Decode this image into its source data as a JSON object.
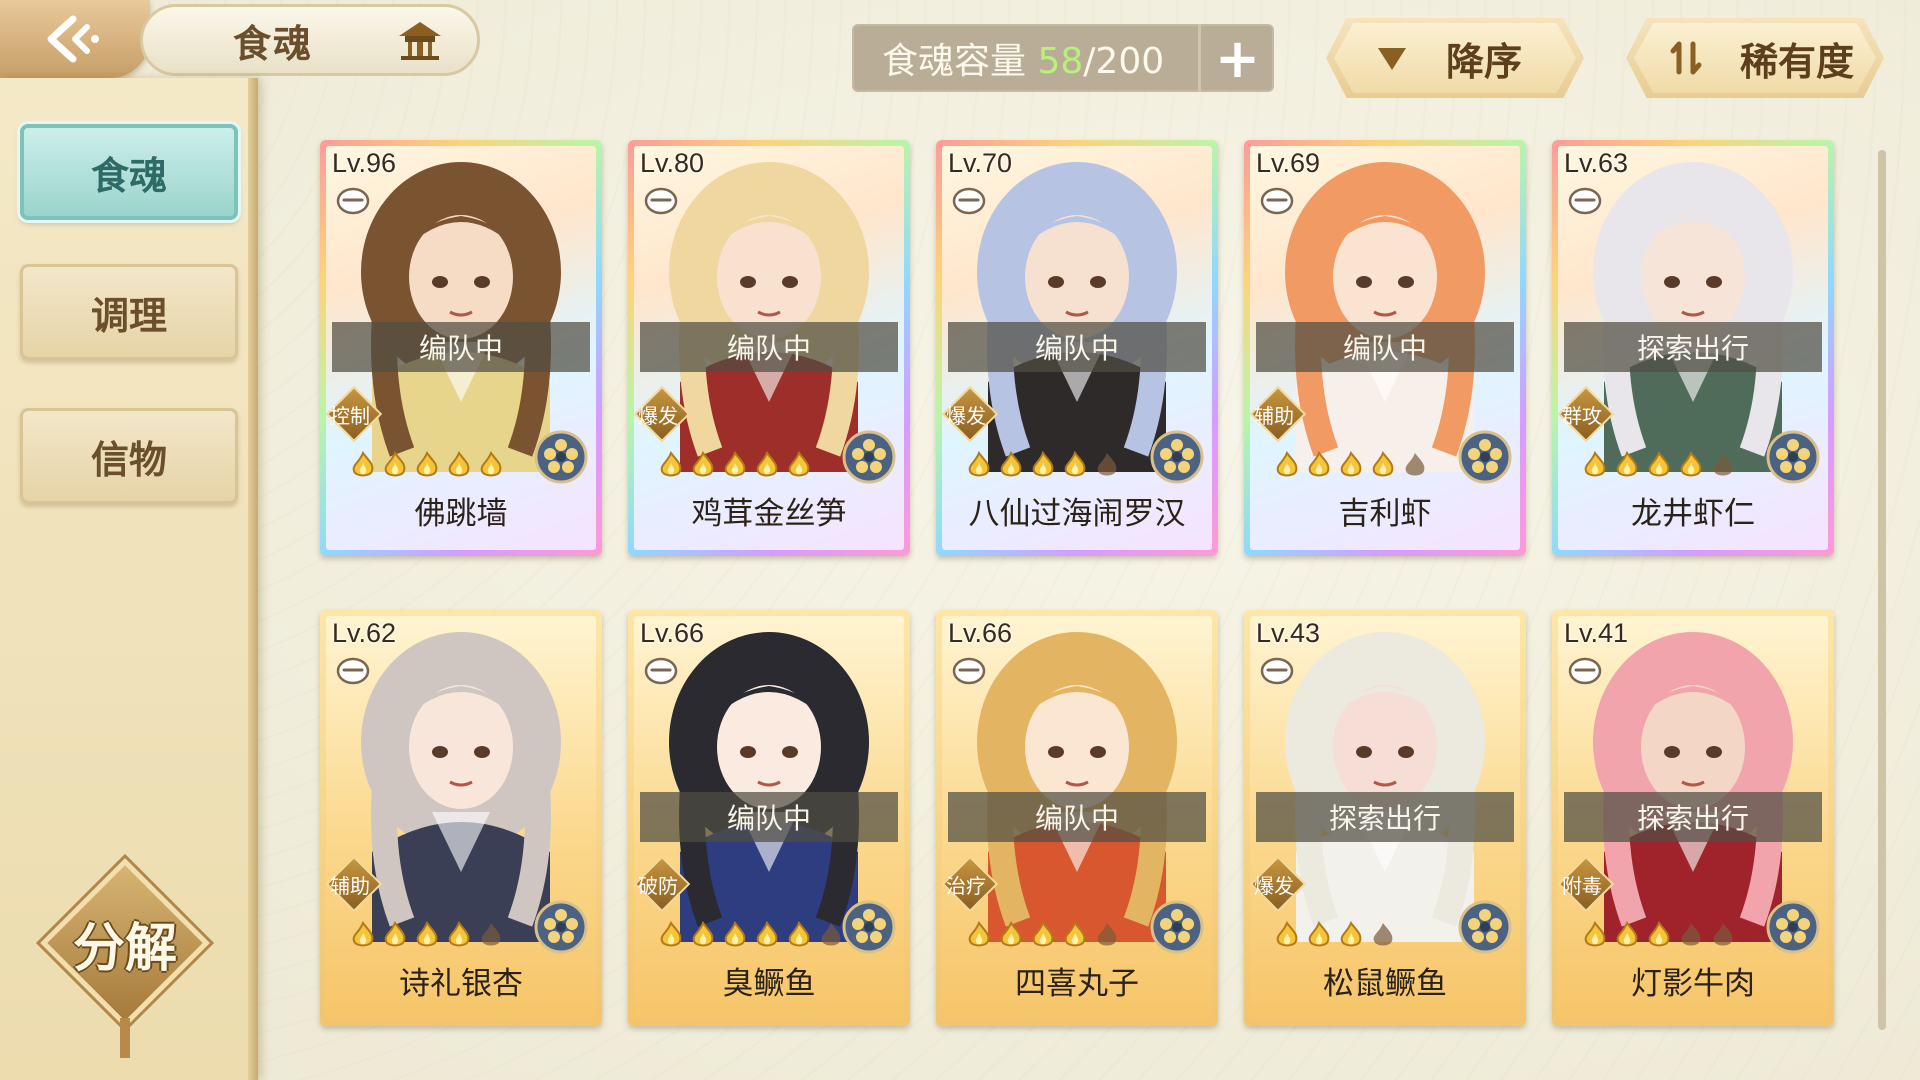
{
  "header": {
    "title": "食魂",
    "back_icon": "back-arrow-icon",
    "crown_icon": "pavilion-icon",
    "capacity_label": "食魂容量",
    "capacity_current": "58",
    "capacity_max": "/200",
    "add_label": "+"
  },
  "sort": {
    "order_label": "降序",
    "rarity_label": "稀有度"
  },
  "sidebar": {
    "items": [
      {
        "label": "食魂",
        "active": true
      },
      {
        "label": "调理",
        "active": false
      },
      {
        "label": "信物",
        "active": false
      }
    ],
    "decompose_label": "分解"
  },
  "cards": [
    {
      "level": "Lv.96",
      "status": "编队中",
      "role": "控制",
      "name": "佛跳墙",
      "stars": 5,
      "half": 0,
      "frame": "rainbow",
      "hair": "#7a5330",
      "skin": "#f6dcc4",
      "outfit": "#e8d58c"
    },
    {
      "level": "Lv.80",
      "status": "编队中",
      "role": "爆发",
      "name": "鸡茸金丝笋",
      "stars": 5,
      "half": 0,
      "frame": "rainbow",
      "hair": "#f0d7a0",
      "skin": "#f8e2cf",
      "outfit": "#9e2e2a"
    },
    {
      "level": "Lv.70",
      "status": "编队中",
      "role": "爆发",
      "name": "八仙过海闹罗汉",
      "stars": 4,
      "half": 1,
      "frame": "rainbow",
      "hair": "#b7c3e3",
      "skin": "#f6e1d0",
      "outfit": "#2e2a2a"
    },
    {
      "level": "Lv.69",
      "status": "编队中",
      "role": "辅助",
      "name": "吉利虾",
      "stars": 4,
      "half": 1,
      "frame": "rainbow",
      "hair": "#f19a64",
      "skin": "#fbe3d2",
      "outfit": "#f7f0ea"
    },
    {
      "level": "Lv.63",
      "status": "探索出行",
      "role": "群攻",
      "name": "龙井虾仁",
      "stars": 4,
      "half": 1,
      "frame": "rainbow",
      "hair": "#e8e6ea",
      "skin": "#f6e4d8",
      "outfit": "#4f6c5a"
    },
    {
      "level": "Lv.62",
      "status": "",
      "role": "辅助",
      "name": "诗礼银杏",
      "stars": 4,
      "half": 1,
      "frame": "gold",
      "hair": "#cfc6c2",
      "skin": "#f8e6da",
      "outfit": "#3b3f55"
    },
    {
      "level": "Lv.66",
      "status": "编队中",
      "role": "破防",
      "name": "臭鳜鱼",
      "stars": 5,
      "half": 1,
      "frame": "gold",
      "hair": "#2a2a30",
      "skin": "#fbeadf",
      "outfit": "#2d3d80"
    },
    {
      "level": "Lv.66",
      "status": "编队中",
      "role": "治疗",
      "name": "四喜丸子",
      "stars": 4,
      "half": 1,
      "frame": "gold",
      "hair": "#e3b562",
      "skin": "#fbe6d2",
      "outfit": "#d9572e"
    },
    {
      "level": "Lv.43",
      "status": "探索出行",
      "role": "爆发",
      "name": "松鼠鳜鱼",
      "stars": 3,
      "half": 1,
      "frame": "gold",
      "hair": "#ece9df",
      "skin": "#f6ddd6",
      "outfit": "#f3f1ec"
    },
    {
      "level": "Lv.41",
      "status": "探索出行",
      "role": "附毒",
      "name": "灯影牛肉",
      "stars": 3,
      "half": 2,
      "frame": "gold",
      "hair": "#f2a4ac",
      "skin": "#f3d6c6",
      "outfit": "#a0222a"
    }
  ],
  "colors": {
    "accent_teal": "#9ad4cc",
    "capacity_green": "#b8f07a",
    "brown_text": "#6b4e2c"
  }
}
